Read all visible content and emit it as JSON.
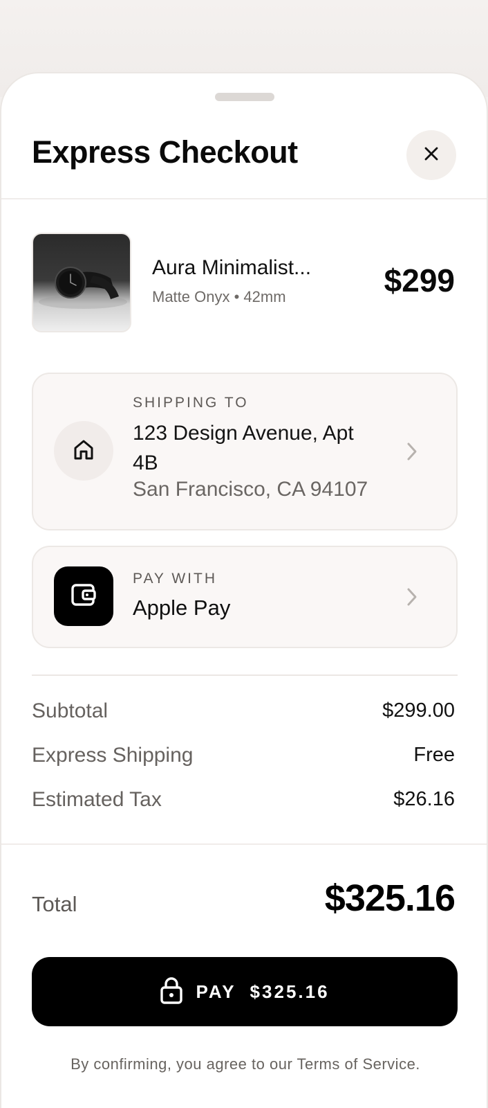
{
  "header": {
    "title": "Express Checkout"
  },
  "product": {
    "name": "Aura Minimalist...",
    "variant": "Matte Onyx • 42mm",
    "price": "$299"
  },
  "shipping": {
    "label": "SHIPPING TO",
    "address_line1": "123 Design Avenue, Apt 4B",
    "address_line2": "San Francisco, CA 94107"
  },
  "payment": {
    "label": "PAY WITH",
    "method": "Apple Pay"
  },
  "summary": {
    "subtotal_label": "Subtotal",
    "subtotal_value": "$299.00",
    "shipping_label": "Express Shipping",
    "shipping_value": "Free",
    "tax_label": "Estimated Tax",
    "tax_value": "$26.16"
  },
  "total": {
    "label": "Total",
    "value": "$325.16"
  },
  "pay_button": {
    "label": "PAY  $325.16"
  },
  "terms": "By confirming, you agree to our Terms of Service.",
  "icons": {
    "close": "close-icon",
    "home": "home-icon",
    "wallet": "wallet-icon",
    "chevron": "chevron-right-icon",
    "lock": "lock-icon"
  },
  "colors": {
    "accent": "#000000",
    "background": "#f3f0ee",
    "card": "#faf7f6"
  }
}
